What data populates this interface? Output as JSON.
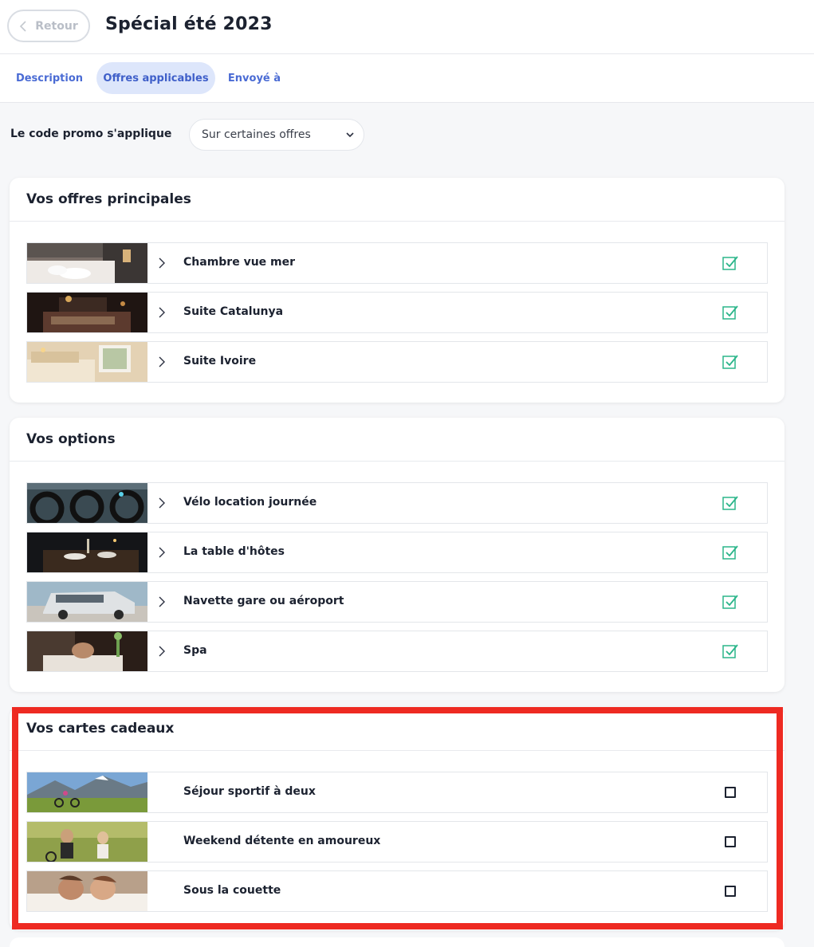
{
  "header": {
    "back_label": "Retour",
    "title": "Spécial été 2023"
  },
  "tabs": [
    {
      "label": "Description",
      "active": false
    },
    {
      "label": "Offres applicables",
      "active": true
    },
    {
      "label": "Envoyé à",
      "active": false
    }
  ],
  "promo": {
    "label": "Le code promo s'applique",
    "selected": "Sur certaines offres"
  },
  "sections": [
    {
      "title": "Vos offres principales",
      "items": [
        {
          "label": "Chambre vue mer",
          "checked": true,
          "image": "hotel-room-photo"
        },
        {
          "label": "Suite Catalunya",
          "checked": true,
          "image": "dark-suite-photo"
        },
        {
          "label": "Suite Ivoire",
          "checked": true,
          "image": "ivory-suite-photo"
        }
      ]
    },
    {
      "title": "Vos options",
      "items": [
        {
          "label": "Vélo location journée",
          "checked": true,
          "image": "bikes-photo"
        },
        {
          "label": "La table d'hôtes",
          "checked": true,
          "image": "dinner-table-photo"
        },
        {
          "label": "Navette gare ou aéroport",
          "checked": true,
          "image": "van-photo"
        },
        {
          "label": "Spa",
          "checked": true,
          "image": "spa-photo"
        }
      ]
    },
    {
      "title": "Vos cartes cadeaux",
      "items": [
        {
          "label": "Séjour sportif à deux",
          "checked": false,
          "image": "mountain-bikers-photo"
        },
        {
          "label": "Weekend détente en amoureux",
          "checked": false,
          "image": "couple-cycling-photo"
        },
        {
          "label": "Sous la couette",
          "checked": false,
          "image": "couple-bed-photo"
        }
      ]
    }
  ],
  "colors": {
    "accent": "#4a6bd4",
    "tab_active_bg": "#dde6fb",
    "check_green": "#2bb58a",
    "highlight_red": "#ee2a22"
  }
}
